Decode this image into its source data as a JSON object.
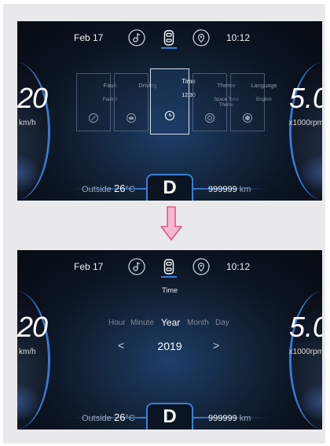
{
  "colors": {
    "accent": "#3b7fd8",
    "arrow_fill": "#f5b8d0",
    "arrow_stroke": "#d85a8a",
    "frame": "#e9e9eb"
  },
  "status": {
    "date": "Feb 17",
    "time": "10:12",
    "icons": [
      "music-icon",
      "car-icon",
      "location-pin-icon"
    ]
  },
  "speed": {
    "value": "20",
    "unit": "km/h"
  },
  "rpm": {
    "value": "5.0",
    "unit": "x1000rpm"
  },
  "gear": "D",
  "outside": {
    "label": "Outside",
    "temp": "26",
    "unit": "°C"
  },
  "odometer": {
    "value": "999999",
    "unit": "km"
  },
  "menu_cards": [
    {
      "label": "Fault",
      "value": "Fault 0",
      "icon": "fault-icon"
    },
    {
      "label": "Driving",
      "value": "",
      "icon": "car-front-icon"
    },
    {
      "label": "Time",
      "value": "12:30",
      "icon": "clock-icon"
    },
    {
      "label": "Theme",
      "value": "Space Time Theme",
      "icon": "theme-icon"
    },
    {
      "label": "Language",
      "value": "English",
      "icon": "language-icon"
    }
  ],
  "time_screen": {
    "title": "Time",
    "segments": [
      "Hour",
      "Minute",
      "Year",
      "Month",
      "Day"
    ],
    "selected_segment": "Year",
    "value": "2019",
    "prev_symbol": "<",
    "next_symbol": ">"
  }
}
